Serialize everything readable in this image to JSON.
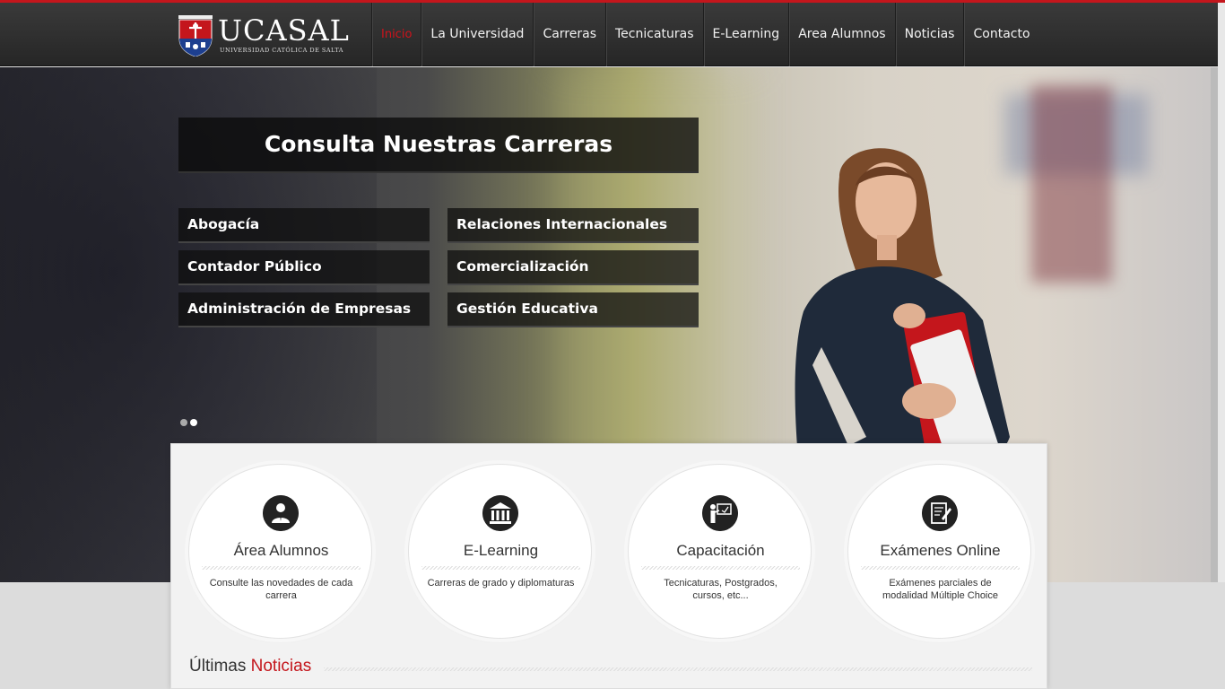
{
  "brand": {
    "name": "UCASAL",
    "subtitle": "UNIVERSIDAD CATÓLICA DE SALTA"
  },
  "colors": {
    "accent": "#c4161c",
    "header_bg": "#2c2c2c"
  },
  "nav": {
    "items": [
      {
        "label": "Inicio",
        "active": true
      },
      {
        "label": "La Universidad"
      },
      {
        "label": "Carreras"
      },
      {
        "label": "Tecnicaturas"
      },
      {
        "label": "E-Learning"
      },
      {
        "label": "Area Alumnos"
      },
      {
        "label": "Noticias"
      },
      {
        "label": "Contacto"
      }
    ]
  },
  "hero": {
    "title": "Consulta Nuestras Carreras",
    "careers": [
      "Abogacía",
      "Relaciones Internacionales",
      "Contador Público",
      "Comercialización",
      "Administración de Empresas",
      "Gestión Educativa"
    ],
    "slides": 2,
    "active_slide": 2
  },
  "features": [
    {
      "title": "Área Alumnos",
      "desc": "Consulte las novedades de cada carrera",
      "icon": "student-icon"
    },
    {
      "title": "E-Learning",
      "desc": "Carreras de grado y diplomaturas",
      "icon": "institution-icon"
    },
    {
      "title": "Capacitación",
      "desc": "Tecnicaturas, Postgrados, cursos, etc...",
      "icon": "teacher-icon"
    },
    {
      "title": "Exámenes Online",
      "desc": "Exámenes parciales de modalidad Múltiple Choice",
      "icon": "exam-icon"
    }
  ],
  "news": {
    "heading_plain": "Últimas",
    "heading_accent": "Noticias"
  }
}
